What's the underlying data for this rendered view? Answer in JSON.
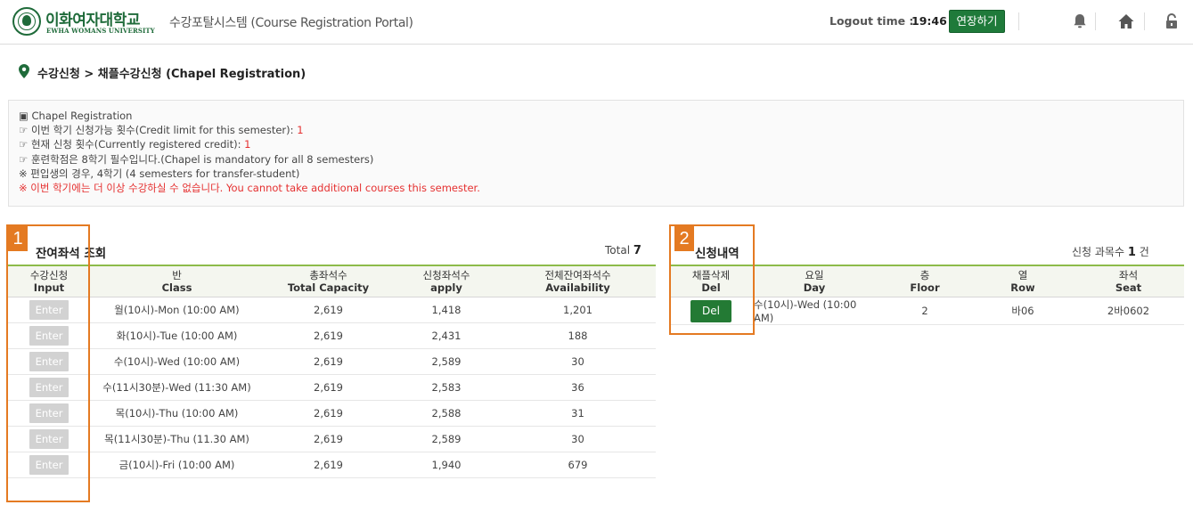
{
  "header": {
    "brand_ko": "이화여자대학교",
    "brand_en": "EWHA WOMANS UNIVERSITY",
    "portal_title": "수강포탈시스템 (Course Registration Portal)",
    "logout_label": "Logout time :",
    "logout_time": "19:46",
    "extend_button": "연장하기",
    "icons": [
      "bell-icon",
      "home-icon",
      "lock-icon"
    ]
  },
  "breadcrumb": {
    "text": "수강신청 > 채플수강신청 (Chapel Registration)"
  },
  "info": {
    "title": "Chapel Registration",
    "lines": [
      {
        "prefix": "☞ 이번 학기 신청가능 횟수(Credit limit for this semester): ",
        "value": "1"
      },
      {
        "prefix": "☞ 현재 신청 횟수(Currently registered credit): ",
        "value": "1"
      },
      {
        "prefix": "☞ 훈련학점은 8학기 필수입니다.(Chapel is mandatory for all 8 semesters)",
        "value": ""
      },
      {
        "prefix": "※ 편입생의 경우, 4학기 (4 semesters for transfer-student)",
        "value": ""
      }
    ],
    "warning": "※ 이번 학기에는 더 이상 수강하실 수 없습니다.   You cannot take additional courses this semester."
  },
  "left_section": {
    "title": "잔여좌석 조회",
    "total_label": "Total",
    "total_value": "7",
    "columns": [
      {
        "ko": "수강신청",
        "en": "Input"
      },
      {
        "ko": "반",
        "en": "Class"
      },
      {
        "ko": "총좌석수",
        "en": "Total Capacity"
      },
      {
        "ko": "신청좌석수",
        "en": "apply"
      },
      {
        "ko": "전체잔여좌석수",
        "en": "Availability"
      }
    ],
    "button_label": "Enter",
    "rows": [
      {
        "class": "월(10시)-Mon (10:00 AM)",
        "capacity": "2,619",
        "apply": "1,418",
        "available": "1,201"
      },
      {
        "class": "화(10시)-Tue (10:00 AM)",
        "capacity": "2,619",
        "apply": "2,431",
        "available": "188"
      },
      {
        "class": "수(10시)-Wed (10:00 AM)",
        "capacity": "2,619",
        "apply": "2,589",
        "available": "30"
      },
      {
        "class": "수(11시30분)-Wed (11:30 AM)",
        "capacity": "2,619",
        "apply": "2,583",
        "available": "36"
      },
      {
        "class": "목(10시)-Thu (10:00 AM)",
        "capacity": "2,619",
        "apply": "2,588",
        "available": "31"
      },
      {
        "class": "목(11시30분)-Thu (11.30 AM)",
        "capacity": "2,619",
        "apply": "2,589",
        "available": "30"
      },
      {
        "class": "금(10시)-Fri (10:00 AM)",
        "capacity": "2,619",
        "apply": "1,940",
        "available": "679"
      }
    ]
  },
  "right_section": {
    "title": "신청내역",
    "count_label": "신청 과목수",
    "count_value": "1",
    "count_unit": "건",
    "columns": [
      {
        "ko": "채플삭제",
        "en": "Del"
      },
      {
        "ko": "요일",
        "en": "Day"
      },
      {
        "ko": "층",
        "en": "Floor"
      },
      {
        "ko": "열",
        "en": "Row"
      },
      {
        "ko": "좌석",
        "en": "Seat"
      }
    ],
    "button_label": "Del",
    "rows": [
      {
        "day": "수(10시)-Wed (10:00 AM)",
        "floor": "2",
        "row": "바06",
        "seat": "2바0602"
      }
    ]
  },
  "annotations": {
    "one": "1",
    "two": "2",
    "color": "#e47a22"
  },
  "colors": {
    "brand_green": "#1f6b3a",
    "button_green": "#237a34",
    "header_rule": "#8dbb4a",
    "warning_red": "#e53030"
  }
}
